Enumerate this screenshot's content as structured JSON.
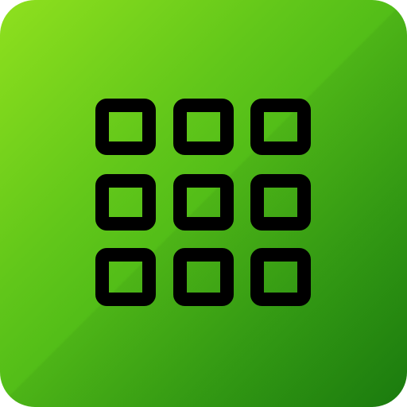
{
  "app_icon": {
    "name": "grid-app-icon",
    "icon": "grid-3x3-icon",
    "colors": {
      "gradient_start": "#8fe01e",
      "gradient_end": "#1e8610",
      "glyph_stroke": "#000000"
    },
    "grid": {
      "rows": 3,
      "columns": 3
    }
  }
}
